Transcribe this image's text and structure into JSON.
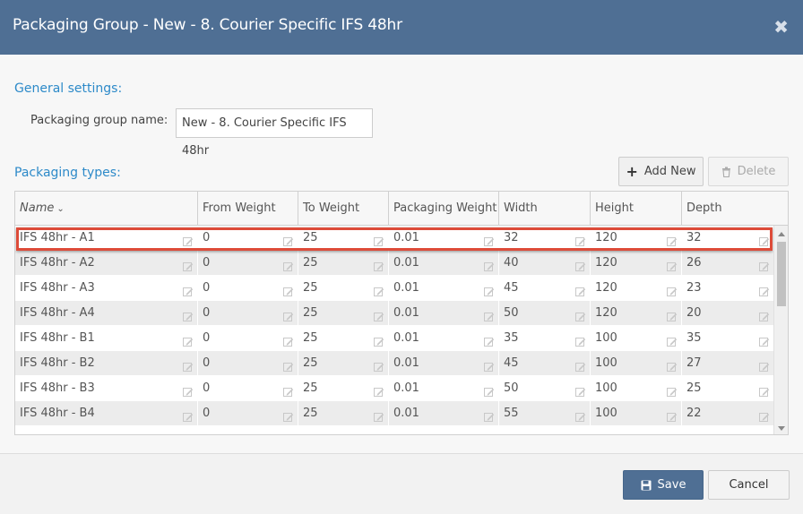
{
  "dialog": {
    "title": "Packaging Group - New - 8. Courier Specific IFS 48hr",
    "close_icon": "close-icon"
  },
  "general": {
    "section_label": "General settings:",
    "name_label": "Packaging group name:",
    "name_value": "New - 8. Courier Specific IFS 48hr"
  },
  "types": {
    "section_label": "Packaging types:",
    "add_label": "Add New",
    "delete_label": "Delete",
    "columns": [
      "Name",
      "From Weight",
      "To Weight",
      "Packaging Weight",
      "Width",
      "Height",
      "Depth"
    ],
    "sort_icon": "chevron-down-icon",
    "edit_icon": "edit-icon",
    "selected_row": 0,
    "rows": [
      [
        "IFS 48hr - A1",
        "0",
        "25",
        "0.01",
        "32",
        "120",
        "32"
      ],
      [
        "IFS 48hr - A2",
        "0",
        "25",
        "0.01",
        "40",
        "120",
        "26"
      ],
      [
        "IFS 48hr - A3",
        "0",
        "25",
        "0.01",
        "45",
        "120",
        "23"
      ],
      [
        "IFS 48hr - A4",
        "0",
        "25",
        "0.01",
        "50",
        "120",
        "20"
      ],
      [
        "IFS 48hr - B1",
        "0",
        "25",
        "0.01",
        "35",
        "100",
        "35"
      ],
      [
        "IFS 48hr - B2",
        "0",
        "25",
        "0.01",
        "45",
        "100",
        "27"
      ],
      [
        "IFS 48hr - B3",
        "0",
        "25",
        "0.01",
        "50",
        "100",
        "25"
      ],
      [
        "IFS 48hr - B4",
        "0",
        "25",
        "0.01",
        "55",
        "100",
        "22"
      ]
    ]
  },
  "footer": {
    "save_label": "Save",
    "cancel_label": "Cancel"
  },
  "colors": {
    "header_bg": "#4f6f94",
    "accent": "#2d8ac9",
    "selection_outline": "#dd4b39"
  }
}
